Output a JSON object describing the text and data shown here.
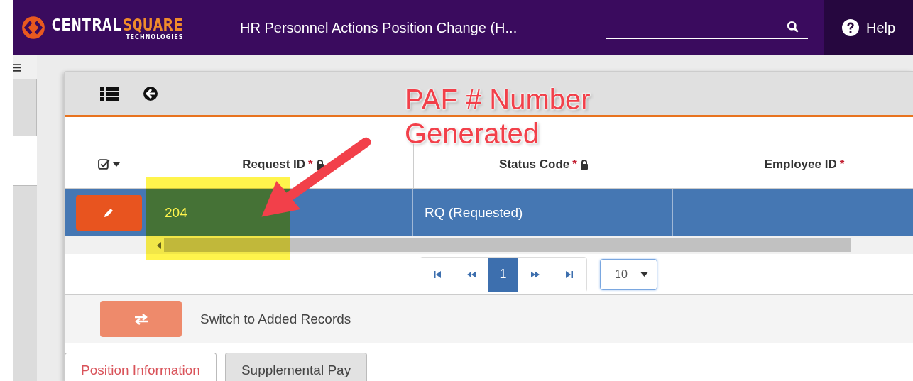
{
  "header": {
    "logo": {
      "brand_main": "CENTRAL",
      "brand_accent": "SQUARE",
      "tagline": "TECHNOLOGIES"
    },
    "title": "HR Personnel Actions Position Change (H...",
    "help": "Help"
  },
  "table": {
    "columns": [
      {
        "label": "Request ID",
        "required_mark": "*",
        "locked": true
      },
      {
        "label": "Status Code",
        "required_mark": "*",
        "locked": true
      },
      {
        "label": "Employee ID",
        "required_mark": "*",
        "locked": false
      }
    ],
    "rows": [
      {
        "selected": true,
        "cells": [
          "204",
          "RQ (Requested)",
          ""
        ]
      }
    ]
  },
  "pager": {
    "pages": [
      {
        "label": "1",
        "selected": true
      }
    ],
    "page_size": "10"
  },
  "switch": {
    "label": "Switch to Added Records"
  },
  "tabs": [
    {
      "label": "Position Information",
      "selected": true
    },
    {
      "label": "Supplemental Pay",
      "selected": false
    }
  ],
  "annotation": {
    "lines": [
      "PAF # Number",
      "Generated"
    ]
  }
}
